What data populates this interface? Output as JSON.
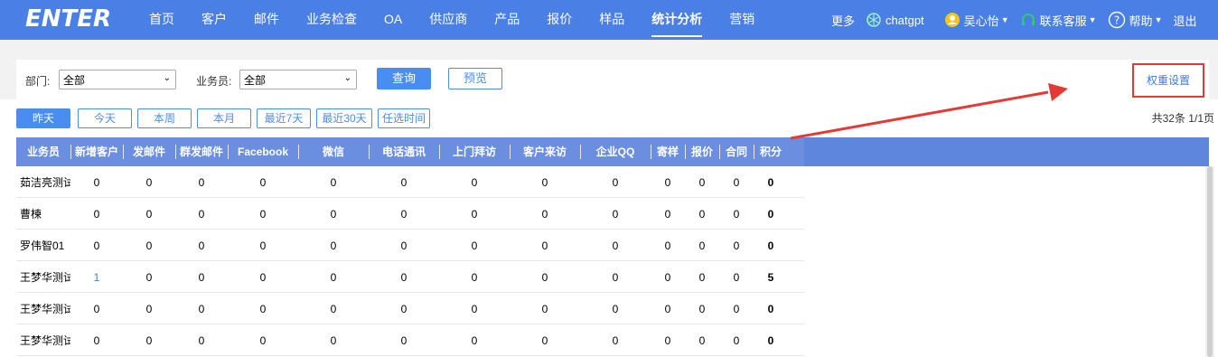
{
  "brand": {
    "logo_text": "ENTER"
  },
  "nav": {
    "items": [
      {
        "label": "首页"
      },
      {
        "label": "客户"
      },
      {
        "label": "邮件"
      },
      {
        "label": "业务检查"
      },
      {
        "label": "OA"
      },
      {
        "label": "供应商"
      },
      {
        "label": "产品"
      },
      {
        "label": "报价"
      },
      {
        "label": "样品"
      },
      {
        "label": "统计分析"
      },
      {
        "label": "营销"
      }
    ],
    "active_index": 9,
    "more_label": "更多",
    "chatgpt_label": "chatgpt",
    "user_label": "吴心怡",
    "support_label": "联系客服",
    "help_label": "帮助",
    "logout_label": "退出"
  },
  "filter": {
    "dept_label": "部门:",
    "dept_value": "全部",
    "salesperson_label": "业务员:",
    "salesperson_value": "全部",
    "query_label": "查询",
    "preview_label": "预览",
    "weight_settings_label": "权重设置"
  },
  "date_tabs": [
    {
      "label": "昨天"
    },
    {
      "label": "今天"
    },
    {
      "label": "本周"
    },
    {
      "label": "本月"
    },
    {
      "label": "最近7天"
    },
    {
      "label": "最近30天"
    },
    {
      "label": "任选时间"
    }
  ],
  "date_tabs_active": 0,
  "paging_text": "共32条 1/1页",
  "table": {
    "columns": [
      "业务员",
      "新增客户",
      "发邮件",
      "群发邮件",
      "Facebook",
      "微信",
      "电话通讯",
      "上门拜访",
      "客户来访",
      "企业QQ",
      "寄样",
      "报价",
      "合同",
      "积分"
    ],
    "rows": [
      [
        "茹洁亮测试",
        "0",
        "0",
        "0",
        "0",
        "0",
        "0",
        "0",
        "0",
        "0",
        "0",
        "0",
        "0",
        "0"
      ],
      [
        "曹楝",
        "0",
        "0",
        "0",
        "0",
        "0",
        "0",
        "0",
        "0",
        "0",
        "0",
        "0",
        "0",
        "0"
      ],
      [
        "罗伟智01",
        "0",
        "0",
        "0",
        "0",
        "0",
        "0",
        "0",
        "0",
        "0",
        "0",
        "0",
        "0",
        "0"
      ],
      [
        "王梦华测试",
        "1",
        "0",
        "0",
        "0",
        "0",
        "0",
        "0",
        "0",
        "0",
        "0",
        "0",
        "0",
        "5"
      ],
      [
        "王梦华测试",
        "0",
        "0",
        "0",
        "0",
        "0",
        "0",
        "0",
        "0",
        "0",
        "0",
        "0",
        "0",
        "0"
      ],
      [
        "王梦华测试",
        "0",
        "0",
        "0",
        "0",
        "0",
        "0",
        "0",
        "0",
        "0",
        "0",
        "0",
        "0",
        "0"
      ]
    ]
  },
  "colors": {
    "topbar": "#4a7fe6",
    "table_header": "#6b8ee0",
    "accent": "#4a8df0",
    "highlight_box": "#e53935"
  }
}
